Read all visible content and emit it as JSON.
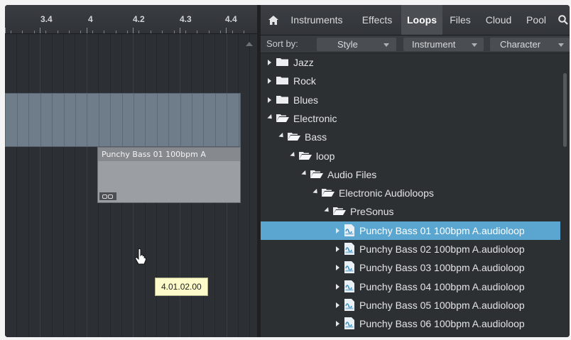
{
  "ruler": {
    "labels": [
      "3.4",
      "4",
      "4.2",
      "4.3",
      "4.4"
    ]
  },
  "events": {
    "light_event_name": "Punchy Bass 01 100bpm A"
  },
  "tooltip": {
    "position": "4.01.02.00"
  },
  "browser": {
    "tabs": [
      {
        "label": "Instruments",
        "active": false
      },
      {
        "label": "Effects",
        "active": false
      },
      {
        "label": "Loops",
        "active": true
      },
      {
        "label": "Files",
        "active": false
      },
      {
        "label": "Cloud",
        "active": false
      },
      {
        "label": "Pool",
        "active": false
      }
    ],
    "sort": {
      "label": "Sort by:",
      "options": [
        "Style",
        "Instrument",
        "Character"
      ]
    },
    "tree": [
      {
        "label": "Jazz",
        "depth": 0,
        "type": "folder",
        "expanded": false,
        "selected": false
      },
      {
        "label": "Rock",
        "depth": 0,
        "type": "folder",
        "expanded": false,
        "selected": false
      },
      {
        "label": "Blues",
        "depth": 0,
        "type": "folder",
        "expanded": false,
        "selected": false
      },
      {
        "label": "Electronic",
        "depth": 0,
        "type": "folder",
        "expanded": true,
        "selected": false
      },
      {
        "label": "Bass",
        "depth": 1,
        "type": "folder",
        "expanded": true,
        "selected": false
      },
      {
        "label": "loop",
        "depth": 2,
        "type": "folder",
        "expanded": true,
        "selected": false
      },
      {
        "label": "Audio Files",
        "depth": 3,
        "type": "folder",
        "expanded": true,
        "selected": false
      },
      {
        "label": "Electronic Audioloops",
        "depth": 4,
        "type": "folder",
        "expanded": true,
        "selected": false
      },
      {
        "label": "PreSonus",
        "depth": 5,
        "type": "folder",
        "expanded": true,
        "selected": false
      },
      {
        "label": "Punchy Bass 01 100bpm A.audioloop",
        "depth": 6,
        "type": "file",
        "expanded": false,
        "selected": true
      },
      {
        "label": "Punchy Bass 02 100bpm A.audioloop",
        "depth": 6,
        "type": "file",
        "expanded": false,
        "selected": false
      },
      {
        "label": "Punchy Bass 03 100bpm A.audioloop",
        "depth": 6,
        "type": "file",
        "expanded": false,
        "selected": false
      },
      {
        "label": "Punchy Bass 04 100bpm A.audioloop",
        "depth": 6,
        "type": "file",
        "expanded": false,
        "selected": false
      },
      {
        "label": "Punchy Bass 05 100bpm A.audioloop",
        "depth": 6,
        "type": "file",
        "expanded": false,
        "selected": false
      },
      {
        "label": "Punchy Bass 06 100bpm A.audioloop",
        "depth": 6,
        "type": "file",
        "expanded": false,
        "selected": false
      }
    ]
  },
  "icons": {
    "home": "home-icon",
    "search": "search-icon",
    "folder": "folder-icon",
    "file": "audioloop-file-icon",
    "loop_marker": "loop-icon",
    "cursor": "hand-cursor-icon"
  },
  "colors": {
    "selection": "#5aa6d0",
    "active_tab": "#4b4f54",
    "tooltip_bg": "#fdfbc9",
    "event_dark": "#6f7d8b",
    "event_light": "#9b9fa3"
  }
}
